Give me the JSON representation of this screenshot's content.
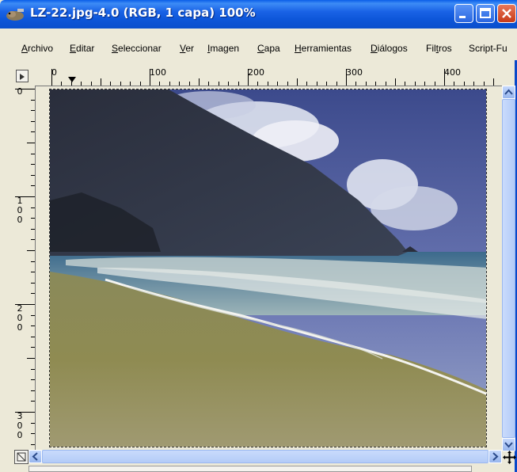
{
  "window": {
    "title": "LZ-22.jpg-4.0 (RGB, 1 capa) 100%"
  },
  "menu": {
    "items": [
      {
        "pre": "",
        "u": "A",
        "post": "rchivo"
      },
      {
        "pre": "",
        "u": "E",
        "post": "ditar"
      },
      {
        "pre": "",
        "u": "S",
        "post": "eleccionar"
      },
      {
        "pre": "",
        "u": "V",
        "post": "er"
      },
      {
        "pre": "",
        "u": "I",
        "post": "magen"
      },
      {
        "pre": "",
        "u": "C",
        "post": "apa"
      },
      {
        "pre": "",
        "u": "H",
        "post": "erramientas"
      },
      {
        "pre": "",
        "u": "D",
        "post": "iálogos"
      },
      {
        "pre": "Fil",
        "u": "t",
        "post": "ros"
      },
      {
        "pre": "Script-Fu",
        "u": "",
        "post": ""
      }
    ]
  },
  "hruler": {
    "labels": [
      "0",
      "100",
      "200",
      "300",
      "400"
    ]
  },
  "vruler": {
    "labels": [
      "0",
      "1\n0\n0",
      "2\n0\n0",
      "3\n0\n0"
    ]
  },
  "icons": {
    "app": "gimp-wilber-icon",
    "minimize": "minimize-icon",
    "maximize": "maximize-icon",
    "close": "close-icon",
    "nav": "navigate-icon",
    "move": "move-arrows-icon"
  },
  "colors": {
    "titlebar": "#0a5ee8",
    "close": "#c83a18",
    "scroll": "#b3cbf7",
    "sky": "#4f5c9c",
    "sand": "#8e8a55"
  }
}
